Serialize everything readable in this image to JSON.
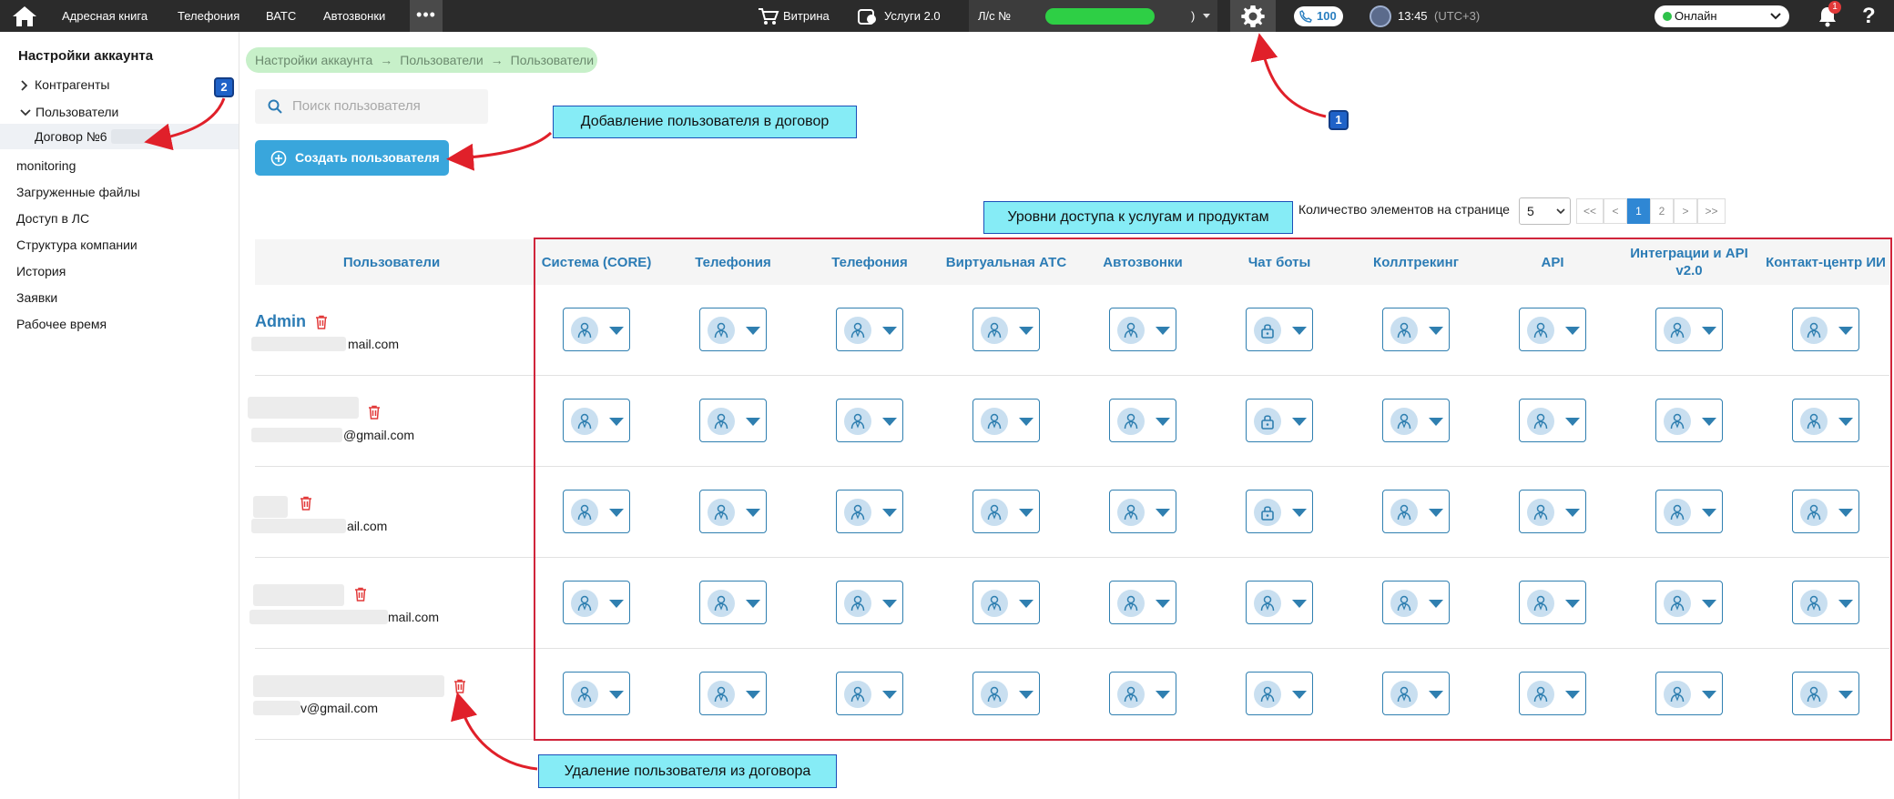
{
  "topbar": {
    "nav": [
      "Адресная книга",
      "Телефония",
      "ВАТС",
      "Автозвонки"
    ],
    "more_glyph": "•••",
    "vitrina": "Витрина",
    "services": "Услуги 2.0",
    "account_label": "Л/с №",
    "account_suffix": ")",
    "calls_count": "100",
    "time": "13:45",
    "timezone": "(UTC+3)",
    "status": "Онлайн",
    "notif_count": "1",
    "help": "?"
  },
  "sidebar": {
    "title": "Настройки аккаунта",
    "items": [
      {
        "label": "Контрагенты",
        "chevron": "›"
      },
      {
        "label": "Пользователи",
        "chevron": "⌄"
      },
      {
        "label": "Договор №6"
      },
      {
        "label": "monitoring"
      },
      {
        "label": "Загруженные файлы"
      },
      {
        "label": "Доступ в ЛС"
      },
      {
        "label": "Структура компании"
      },
      {
        "label": "История"
      },
      {
        "label": "Заявки"
      },
      {
        "label": "Рабочее время"
      }
    ]
  },
  "breadcrumb": [
    "Настройки аккаунта",
    "Пользователи",
    "Пользователи"
  ],
  "breadcrumb_sep": "→",
  "search": {
    "placeholder": "Поиск пользователя"
  },
  "create_button": "Создать пользователя",
  "annotations": {
    "add_user": "Добавление пользователя в договор",
    "access_levels": "Уровни доступа к услугам и продуктам",
    "delete_user": "Удаление пользователя из договора",
    "badge1": "1",
    "badge2": "2"
  },
  "pagination": {
    "label": "Количество элементов на странице",
    "per_page": "5",
    "buttons": [
      "<<",
      "<",
      "1",
      "2",
      ">",
      ">>"
    ],
    "active": "1"
  },
  "table": {
    "user_header": "Пользователи",
    "columns": [
      "Система (CORE)",
      "Телефония",
      "Телефония",
      "Виртуальная АТС",
      "Автозвонки",
      "Чат боты",
      "Коллтрекинг",
      "API",
      "Интеграции и API v2.0",
      "Контакт-центр ИИ"
    ],
    "rows": [
      {
        "name": "Admin",
        "email": "mail.com",
        "icons": [
          "user",
          "user",
          "user",
          "user",
          "user",
          "lock",
          "user",
          "user",
          "user",
          "user"
        ]
      },
      {
        "name": "",
        "email": "@gmail.com",
        "icons": [
          "user",
          "user",
          "user",
          "user",
          "user",
          "lock",
          "user",
          "user",
          "user",
          "user"
        ]
      },
      {
        "name": "",
        "email": "ail.com",
        "icons": [
          "user",
          "user",
          "user",
          "user",
          "user",
          "lock",
          "user",
          "user",
          "user",
          "user"
        ]
      },
      {
        "name": "",
        "email": "mail.com",
        "icons": [
          "user",
          "user",
          "user",
          "user",
          "user",
          "user",
          "user",
          "user",
          "user",
          "user"
        ]
      },
      {
        "name": "",
        "email": "v@gmail.com",
        "icons": [
          "user",
          "user",
          "user",
          "user",
          "user",
          "user",
          "user",
          "user",
          "user",
          "user"
        ]
      }
    ]
  },
  "colors": {
    "accent": "#2c7cb5",
    "button": "#39a6dc",
    "highlight_box": "#d0253b",
    "note_bg": "#86ecf6",
    "breadcrumb_bg": "#c7f0c9"
  }
}
